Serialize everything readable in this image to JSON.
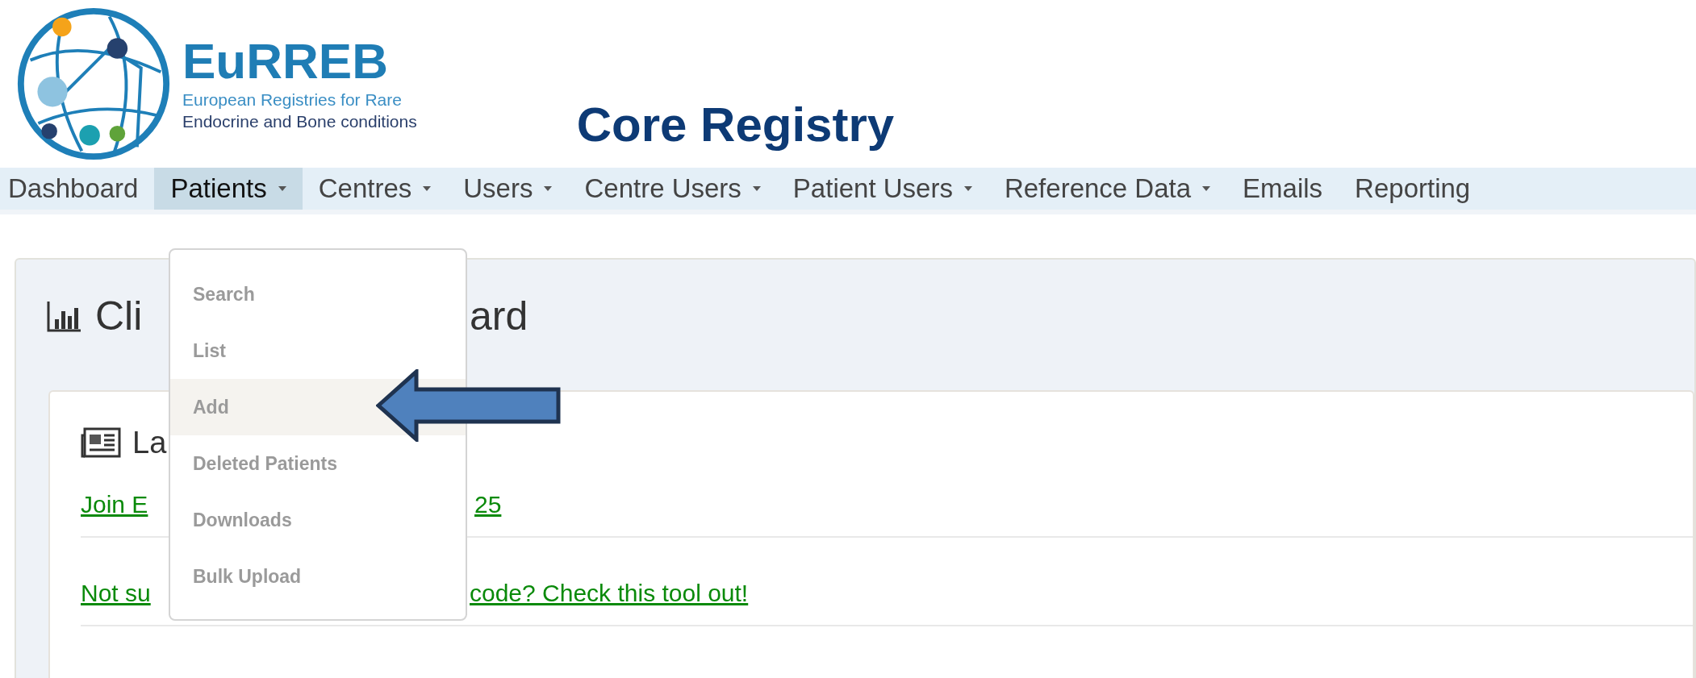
{
  "logo": {
    "name": "EuRREB",
    "tagline_1": "European Registries for Rare",
    "tagline_2": "Endocrine and Bone conditions"
  },
  "title": "Core Registry",
  "nav": [
    {
      "label": "Dashboard",
      "dropdown": false,
      "selected": false
    },
    {
      "label": "Patients",
      "dropdown": true,
      "selected": true
    },
    {
      "label": "Centres",
      "dropdown": true,
      "selected": false
    },
    {
      "label": "Users",
      "dropdown": true,
      "selected": false
    },
    {
      "label": "Centre Users",
      "dropdown": true,
      "selected": false
    },
    {
      "label": "Patient Users",
      "dropdown": true,
      "selected": false
    },
    {
      "label": "Reference Data",
      "dropdown": true,
      "selected": false
    },
    {
      "label": "Emails",
      "dropdown": false,
      "selected": false
    },
    {
      "label": "Reporting",
      "dropdown": false,
      "selected": false
    }
  ],
  "dropdown": {
    "items": [
      {
        "label": "Search",
        "selected": false
      },
      {
        "label": "List",
        "selected": false
      },
      {
        "label": "Add",
        "selected": true
      },
      {
        "label": "Deleted Patients",
        "selected": false
      },
      {
        "label": "Downloads",
        "selected": false
      },
      {
        "label": "Bulk Upload",
        "selected": false
      }
    ]
  },
  "panel": {
    "heading_start": "Cli",
    "heading_end": "ard",
    "news": {
      "title_start": "La",
      "links": [
        {
          "start": "Join E",
          "end": "25"
        },
        {
          "start": "Not su",
          "end": "code? Check this tool out!"
        }
      ]
    }
  }
}
